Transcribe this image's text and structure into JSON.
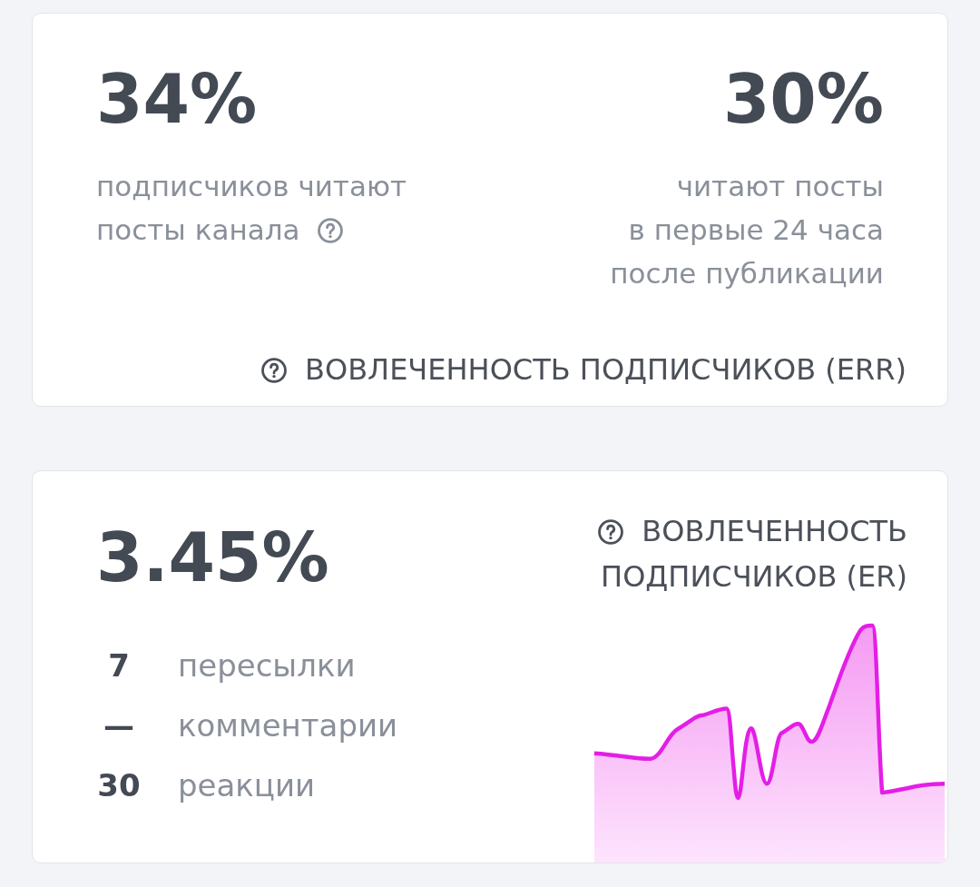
{
  "err_card": {
    "metrics": [
      {
        "value": "34%",
        "caption_lines": [
          "подписчиков читают",
          "посты канала"
        ],
        "help": true
      },
      {
        "value": "30%",
        "caption_lines": [
          "читают посты",
          "в первые 24 часа",
          "после публикации"
        ],
        "help": false
      }
    ],
    "title": "ВОВЛЕЧЕННОСТЬ ПОДПИСЧИКОВ (ERR)",
    "help": true
  },
  "er_card": {
    "value": "3.45%",
    "title_lines": [
      "ВОВЛЕЧЕННОСТЬ",
      "ПОДПИСЧИКОВ (ER)"
    ],
    "help": true,
    "stats": [
      {
        "value": "7",
        "label": "пересылки"
      },
      {
        "value": "—",
        "label": "комментарии"
      },
      {
        "value": "30",
        "label": "реакции"
      }
    ]
  }
}
